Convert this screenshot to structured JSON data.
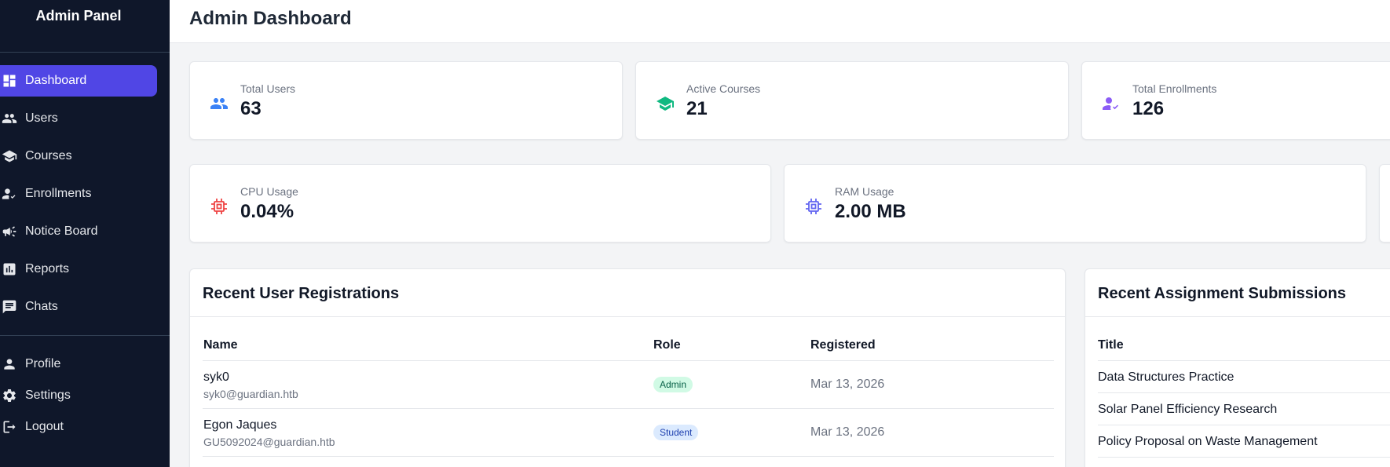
{
  "sidebar": {
    "brand": "Admin Panel",
    "items": [
      {
        "label": "Dashboard",
        "icon": "dashboard-icon",
        "active": true
      },
      {
        "label": "Users",
        "icon": "users-icon"
      },
      {
        "label": "Courses",
        "icon": "graduation-cap-icon"
      },
      {
        "label": "Enrollments",
        "icon": "user-check-icon"
      },
      {
        "label": "Notice Board",
        "icon": "megaphone-icon"
      },
      {
        "label": "Reports",
        "icon": "bar-chart-icon"
      },
      {
        "label": "Chats",
        "icon": "chat-icon"
      }
    ],
    "bottom_items": [
      {
        "label": "Profile",
        "icon": "person-icon"
      },
      {
        "label": "Settings",
        "icon": "gear-icon"
      },
      {
        "label": "Logout",
        "icon": "logout-icon"
      }
    ]
  },
  "header": {
    "title": "Admin Dashboard"
  },
  "stats_row1": [
    {
      "label": "Total Users",
      "value": "63",
      "icon": "users-icon",
      "color": "#3b82f6"
    },
    {
      "label": "Active Courses",
      "value": "21",
      "icon": "graduation-cap-icon",
      "color": "#10b981"
    },
    {
      "label": "Total Enrollments",
      "value": "126",
      "icon": "user-check-icon",
      "color": "#8b5cf6"
    }
  ],
  "stats_row2": [
    {
      "label": "CPU Usage",
      "value": "0.04%",
      "icon": "cpu-icon",
      "color": "#ef4444"
    },
    {
      "label": "RAM Usage",
      "value": "2.00 MB",
      "icon": "memory-chip-icon",
      "color": "#6366f1"
    }
  ],
  "registrations": {
    "title": "Recent User Registrations",
    "columns": [
      "Name",
      "Role",
      "Registered"
    ],
    "rows": [
      {
        "name": "syk0",
        "email": "syk0@guardian.htb",
        "role": "Admin",
        "date": "Mar 13, 2026"
      },
      {
        "name": "Egon Jaques",
        "email": "GU5092024@guardian.htb",
        "role": "Student",
        "date": "Mar 13, 2026"
      }
    ]
  },
  "submissions": {
    "title": "Recent Assignment Submissions",
    "columns": [
      "Title"
    ],
    "rows": [
      {
        "title": "Data Structures Practice"
      },
      {
        "title": "Solar Panel Efficiency Research"
      },
      {
        "title": "Policy Proposal on Waste Management"
      }
    ]
  },
  "colors": {
    "sidebar_bg": "#0f172a",
    "accent": "#5046e5"
  }
}
